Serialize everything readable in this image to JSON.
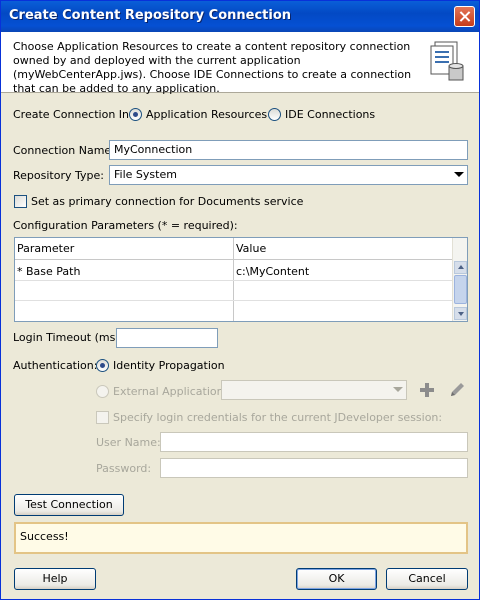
{
  "title": "Create Content Repository Connection",
  "header_text": "Choose Application Resources to create a content repository connection owned by and deployed with the current application (myWebCenterApp.jws). Choose IDE Connections to create a connection that can be added to any application.",
  "create_in": {
    "label": "Create Connection In:",
    "options": [
      "Application Resources",
      "IDE Connections"
    ],
    "selected": "Application Resources"
  },
  "connection_name": {
    "label": "Connection Name:",
    "value": "MyConnection"
  },
  "repository_type": {
    "label": "Repository Type:",
    "value": "File System"
  },
  "primary_checkbox": {
    "label": "Set as primary connection for Documents service",
    "checked": false
  },
  "config": {
    "label": "Configuration Parameters (* = required):",
    "columns": [
      "Parameter",
      "Value"
    ],
    "rows": [
      {
        "parameter": "* Base Path",
        "value": "c:\\MyContent"
      }
    ]
  },
  "login_timeout": {
    "label": "Login Timeout (ms):",
    "value": ""
  },
  "authentication": {
    "label": "Authentication:",
    "identity_label": "Identity Propagation",
    "external_label": "External Application:",
    "external_value": "",
    "selected": "Identity Propagation"
  },
  "login_checkbox": {
    "label": "Specify login credentials for the current JDeveloper session:",
    "checked": false
  },
  "user_name": {
    "label": "User Name:",
    "value": ""
  },
  "password": {
    "label": "Password:",
    "value": ""
  },
  "buttons": {
    "test": "Test Connection",
    "help": "Help",
    "ok": "OK",
    "cancel": "Cancel"
  },
  "status": "Success!",
  "icons": [
    "close-icon",
    "repository-connection-icon",
    "plus-icon",
    "pencil-icon",
    "combo-arrow-icon"
  ]
}
